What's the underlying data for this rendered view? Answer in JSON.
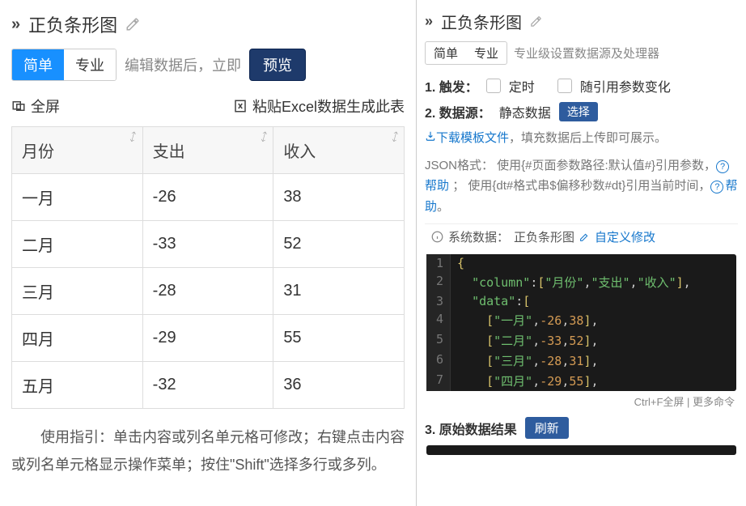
{
  "left": {
    "title": "正负条形图",
    "tabs": {
      "simple": "简单",
      "pro": "专业",
      "active": "simple"
    },
    "edit_hint_prefix": "编辑数据后，立即",
    "preview_btn": "预览",
    "fullscreen": "全屏",
    "paste_excel": "粘贴Excel数据生成此表",
    "guide": "使用指引：单击内容或列名单元格可修改；右键点击内容或列名单元格显示操作菜单；按住\"Shift\"选择多行或多列。"
  },
  "chart_data": {
    "type": "bar",
    "columns": [
      "月份",
      "支出",
      "收入"
    ],
    "rows": [
      [
        "一月",
        -26,
        38
      ],
      [
        "二月",
        -33,
        52
      ],
      [
        "三月",
        -28,
        31
      ],
      [
        "四月",
        -29,
        55
      ],
      [
        "五月",
        -32,
        36
      ]
    ]
  },
  "right": {
    "title": "正负条形图",
    "tabs": {
      "simple": "简单",
      "pro": "专业",
      "active": "pro"
    },
    "pro_hint": "专业级设置数据源及处理器",
    "sec1": {
      "label": "1. 触发：",
      "opt1": "定时",
      "opt2": "随引用参数变化"
    },
    "sec2": {
      "label": "2. 数据源：",
      "value": "静态数据",
      "select_btn": "选择"
    },
    "download_tpl": "下载模板文件",
    "upload_hint": "，填充数据后上传即可展示。",
    "json_fmt": "JSON格式：  使用{#页面参数路径:默认值#}引用参数，",
    "help": "帮助",
    "dt_hint": "；  使用{dt#格式串$偏移秒数#dt}引用当前时间，",
    "period": "。",
    "sys_data_label": "系统数据：",
    "sys_data_value": "正负条形图",
    "sys_edit": "自定义修改",
    "code_lines": [
      "{",
      "  \"column\":[\"月份\",\"支出\",\"收入\"],",
      "  \"data\":[",
      "    [\"一月\",-26,38],",
      "    [\"二月\",-33,52],",
      "    [\"三月\",-28,31],",
      "    [\"四月\",-29,55],"
    ],
    "status": "Ctrl+F全屏 | 更多命令",
    "sec3_label": "3. 原始数据结果",
    "refresh_btn": "刷新"
  }
}
